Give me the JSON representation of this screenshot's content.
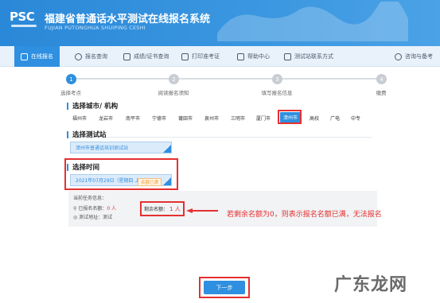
{
  "header": {
    "logo": "PSC",
    "title": "福建省普通话水平测试在线报名系统",
    "subtitle": "FUJIAN PUTONGHUA SHUIPING CESHI",
    "bg_color": "#2f8fe0"
  },
  "nav": {
    "items": [
      {
        "label": "在线报名",
        "icon": "edit-icon"
      },
      {
        "label": "报名查询",
        "icon": "search-icon"
      },
      {
        "label": "成绩/证书查询",
        "icon": "certificate-icon"
      },
      {
        "label": "打印准考证",
        "icon": "printer-icon"
      },
      {
        "label": "帮助中心",
        "icon": "help-icon"
      },
      {
        "label": "测试站联系方式",
        "icon": "contact-icon"
      }
    ],
    "right_label": "咨询与备考",
    "active_index": 0
  },
  "steps": {
    "items": [
      {
        "num": "1",
        "label": "选择考点"
      },
      {
        "num": "2",
        "label": "阅读报名须知"
      },
      {
        "num": "3",
        "label": "填写报名信息"
      },
      {
        "num": "4",
        "label": "缴费"
      }
    ],
    "active_index": 0
  },
  "city_section": {
    "title": "选择城市/ 机构",
    "cities": [
      "福州市",
      "龙岩市",
      "南平市",
      "宁德市",
      "莆田市",
      "泉州市",
      "三明市",
      "厦门市",
      "漳州市",
      "高校",
      "广电",
      "中专"
    ],
    "selected": "漳州市"
  },
  "site_section": {
    "title": "选择测试站",
    "selected": "漳州市普通话培训测试站"
  },
  "time_section": {
    "title": "选择时间",
    "selected": "2021年07月29日（星期四 上午）",
    "tag": "名额已满"
  },
  "info": {
    "heading": "当前任务信息：",
    "registered_label": "已报名名额：",
    "registered_value": "0 人",
    "address_label": "测试地址：",
    "address_value": "测试",
    "remaining_label": "剩余名额：",
    "remaining_value": "1 人"
  },
  "annotation": "若剩余名额为0，则表示报名名额已满，无法报名",
  "next_button": "下一步",
  "watermark": "广东龙网",
  "accent_red": "#e53030"
}
